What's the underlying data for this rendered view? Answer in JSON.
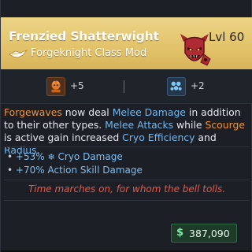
{
  "item": {
    "name": "Frenzied Shatterwight",
    "type": "Forgeknight Class Mod",
    "level": "Lvl 60",
    "rarity_color": "#e3c46c",
    "class_icon": "demon-skull-icon"
  },
  "skills": [
    {
      "icon": "forge-skill-icon",
      "bonus": "+5",
      "color": "#ef9238"
    },
    {
      "icon": "cryo-cluster-icon",
      "bonus": "+2",
      "color": "#74b7ee"
    }
  ],
  "description": {
    "p1": "Forgewaves",
    "p2": " now deal ",
    "p3": "Melee Damage",
    "p4": " in addition to their other types. ",
    "p5": "Melee Attacks",
    "p6": " while ",
    "p7": "Scourge",
    "p8": " is active gain increased ",
    "p9": "Cryo Efficiency",
    "p10": " and ",
    "p11": "Radius",
    "p12": "."
  },
  "stats": [
    {
      "prefix": "• ",
      "value": "+53%",
      "icon": "snowflake-icon",
      "name": "Cryo Damage"
    },
    {
      "prefix": "• ",
      "value": "+70%",
      "name": "Action Skill Damage"
    }
  ],
  "flavor_text": "Time marches on, for whom the bell tolls.",
  "value": {
    "currency": "$",
    "amount": "387,090"
  }
}
